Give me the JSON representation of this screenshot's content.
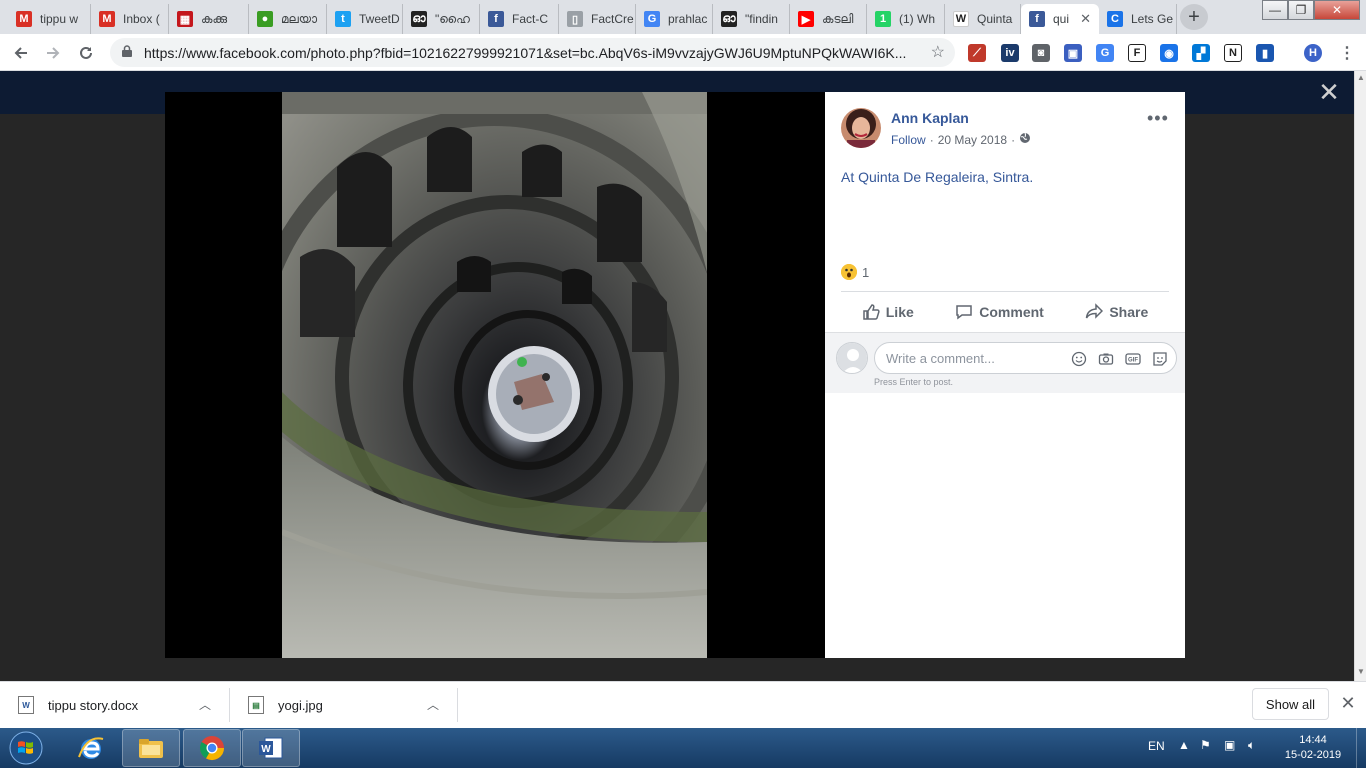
{
  "browser": {
    "tabs": [
      {
        "label": "tippu w",
        "icon": "gmail-icon",
        "color": "#d93025",
        "glyph": "M"
      },
      {
        "label": "Inbox (",
        "icon": "gmail-icon",
        "color": "#d93025",
        "glyph": "M"
      },
      {
        "label": "കക്കു",
        "icon": "grid-logo-icon",
        "color": "#c4161c",
        "glyph": "▦"
      },
      {
        "label": "മലയാ",
        "icon": "green-globe-icon",
        "color": "#3a9d23",
        "glyph": "●"
      },
      {
        "label": "TweetD",
        "icon": "twitter-icon",
        "color": "#1da1f2",
        "glyph": "t"
      },
      {
        "label": "\"ഹൈ",
        "icon": "ml-logo-icon",
        "color": "#222222",
        "glyph": "ഓ"
      },
      {
        "label": "Fact-C",
        "icon": "facebook-icon",
        "color": "#3b5998",
        "glyph": "f"
      },
      {
        "label": "FactCre",
        "icon": "document-icon",
        "color": "#9aa0a6",
        "glyph": "▯"
      },
      {
        "label": "prahlac",
        "icon": "google-icon",
        "color": "#4285f4",
        "glyph": "G"
      },
      {
        "label": "\"findin",
        "icon": "ml-logo-icon",
        "color": "#222222",
        "glyph": "ഓ"
      },
      {
        "label": "കടലി",
        "icon": "youtube-icon",
        "color": "#ff0000",
        "glyph": "▶"
      },
      {
        "label": "(1) Wh",
        "icon": "whatsapp-icon",
        "color": "#25d366",
        "glyph": "1"
      },
      {
        "label": "Quinta",
        "icon": "wikipedia-icon",
        "color": "#ffffff",
        "glyph": "W"
      },
      {
        "label": "qui",
        "icon": "facebook-icon",
        "color": "#3b5998",
        "glyph": "f",
        "active": true
      },
      {
        "label": "Lets Ge",
        "icon": "loading-icon",
        "color": "#1a73e8",
        "glyph": "C"
      }
    ],
    "url": "https://www.facebook.com/photo.php?fbid=10216227999921071&set=bc.AbqV6s-iM9vvzajyGWJ6U9MptuNPQkWAWI6K...",
    "extensions": [
      {
        "name": "pdf-icon",
        "color": "#c0392b",
        "glyph": "⟋"
      },
      {
        "name": "invid-icon",
        "color": "#1b3a6b",
        "glyph": "iv"
      },
      {
        "name": "camera-icon",
        "color": "#5f6368",
        "glyph": "◙"
      },
      {
        "name": "image-search-icon",
        "color": "#3b5fc0",
        "glyph": "▣"
      },
      {
        "name": "translate-icon",
        "color": "#4285f4",
        "glyph": "G"
      },
      {
        "name": "font-icon",
        "color": "#222222",
        "glyph": "F"
      },
      {
        "name": "eye-icon",
        "color": "#1a73e8",
        "glyph": "◉"
      },
      {
        "name": "windows-icon",
        "color": "#0078d7",
        "glyph": "▞"
      },
      {
        "name": "notion-icon",
        "color": "#222222",
        "glyph": "N"
      },
      {
        "name": "bookmark-icon",
        "color": "#1a56b0",
        "glyph": "▮"
      },
      {
        "name": "profile-avatar-icon",
        "color": "#3c63c8",
        "glyph": "H"
      }
    ]
  },
  "post": {
    "author": "Ann Kaplan",
    "follow": "Follow",
    "dot": "·",
    "date": "20 May 2018",
    "text_prefix": "At",
    "location": "Quinta De Regaleira, Sintra.",
    "reaction_count": "1",
    "actions": {
      "like": "Like",
      "comment": "Comment",
      "share": "Share"
    },
    "comment_placeholder": "Write a comment...",
    "comment_hint": "Press Enter to post."
  },
  "downloads": {
    "items": [
      {
        "name": "tippu story.docx",
        "icon": "word-doc-icon"
      },
      {
        "name": "yogi.jpg",
        "icon": "image-file-icon"
      }
    ],
    "show_all": "Show all"
  },
  "taskbar": {
    "language": "EN",
    "time": "14:44",
    "date": "15-02-2019"
  },
  "colors": {
    "facebook_blue": "#365899",
    "overlay": "#262626",
    "chrome_tabstrip": "#dee1e6"
  }
}
